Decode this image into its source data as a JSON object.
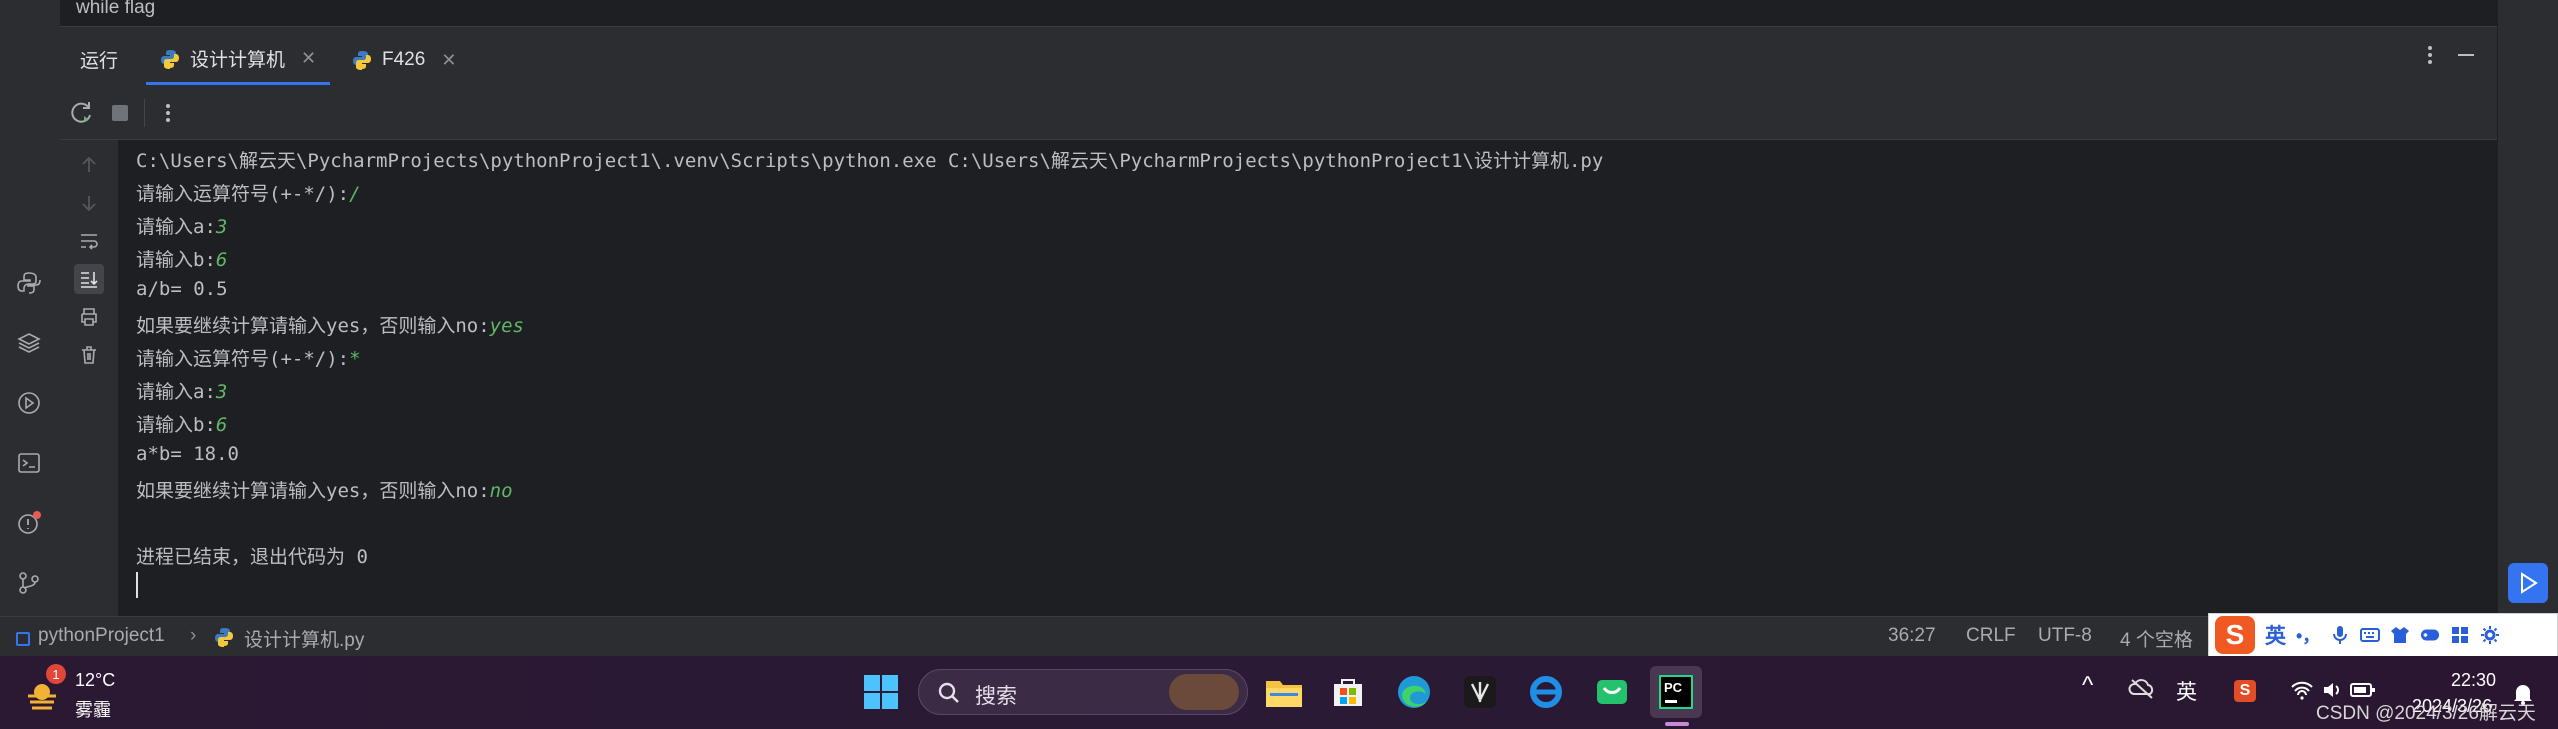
{
  "editor": {
    "residual_text": "while flag"
  },
  "run_window": {
    "title": "运行",
    "tabs": [
      {
        "label": "设计计算机",
        "icon": "python-icon",
        "active": true
      },
      {
        "label": "F426",
        "icon": "python-icon",
        "active": false
      }
    ]
  },
  "console": {
    "lines": [
      {
        "text": "C:\\Users\\解云天\\PycharmProjects\\pythonProject1\\.venv\\Scripts\\python.exe C:\\Users\\解云天\\PycharmProjects\\pythonProject1\\设计计算机.py",
        "input": ""
      },
      {
        "text": "请输入运算符号(+-*/):",
        "input": "/"
      },
      {
        "text": "请输入a:",
        "input": "3"
      },
      {
        "text": "请输入b:",
        "input": "6"
      },
      {
        "text": "a/b= 0.5",
        "input": ""
      },
      {
        "text": "如果要继续计算请输入yes，否则输入no:",
        "input": "yes"
      },
      {
        "text": "请输入运算符号(+-*/):",
        "input": "*"
      },
      {
        "text": "请输入a:",
        "input": "3"
      },
      {
        "text": "请输入b:",
        "input": "6"
      },
      {
        "text": "a*b= 18.0",
        "input": ""
      },
      {
        "text": "如果要继续计算请输入yes，否则输入no:",
        "input": "no"
      },
      {
        "text": "",
        "input": ""
      },
      {
        "text": "进程已结束，退出代码为 0",
        "input": ""
      }
    ]
  },
  "statusbar": {
    "project": "pythonProject1",
    "file": "设计计算机.py",
    "position": "36:27",
    "line_ending": "CRLF",
    "encoding": "UTF-8",
    "indent": "4 个空格"
  },
  "ime": {
    "logo": "S",
    "mode": "英",
    "punct": "•，"
  },
  "taskbar": {
    "weather_temp": "12°C",
    "weather_desc": "雾霾",
    "weather_badge": "1",
    "search_placeholder": "搜索",
    "ime_lang": "英",
    "time": "22:30",
    "date": "2024/3/26",
    "watermark": "CSDN @2024/3/26解云天",
    "pycharm_label": "PC"
  },
  "colors": {
    "accent": "#3574f0",
    "input_text": "#5fb865",
    "background": "#1e1f22",
    "panel": "#2b2d30"
  }
}
